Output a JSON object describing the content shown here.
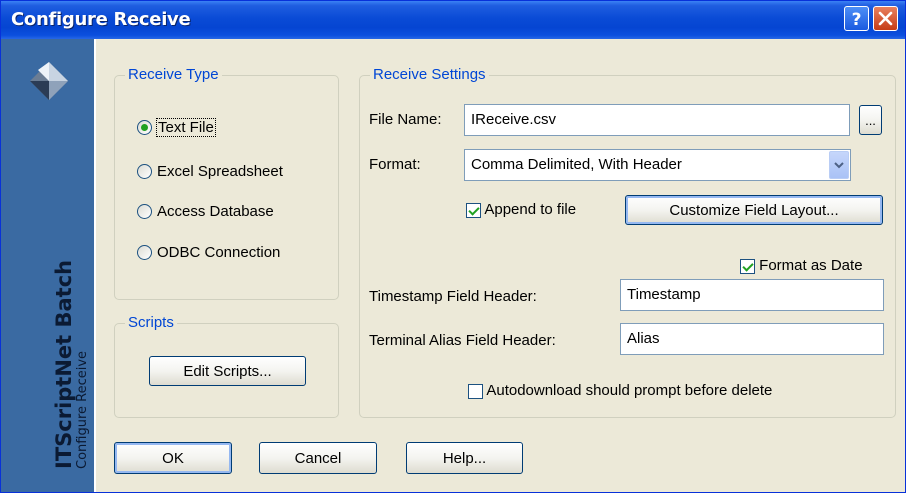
{
  "window": {
    "title": "Configure Receive",
    "help_icon": "question-mark-icon",
    "close_icon": "close-icon"
  },
  "sidebar": {
    "product": "ITScriptNet Batch",
    "subtitle": "Configure Receive",
    "logo_icon": "diamond-logo-icon"
  },
  "receive_type": {
    "legend": "Receive Type",
    "options": [
      {
        "label": "Text File",
        "selected": true
      },
      {
        "label": "Excel Spreadsheet",
        "selected": false
      },
      {
        "label": "Access Database",
        "selected": false
      },
      {
        "label": "ODBC Connection",
        "selected": false
      }
    ]
  },
  "scripts": {
    "legend": "Scripts",
    "edit_label": "Edit Scripts..."
  },
  "settings": {
    "legend": "Receive Settings",
    "file_name_label": "File Name:",
    "file_name_value": "IReceive.csv",
    "browse_label": "...",
    "format_label": "Format:",
    "format_value": "Comma Delimited, With Header",
    "append_label": "Append to file",
    "append_checked": true,
    "customize_label": "Customize Field Layout...",
    "format_date_label": "Format as Date",
    "format_date_checked": true,
    "timestamp_label": "Timestamp Field Header:",
    "timestamp_value": "Timestamp",
    "alias_label": "Terminal Alias Field Header:",
    "alias_value": "Alias",
    "autodownload_label": "Autodownload should prompt before delete",
    "autodownload_checked": false
  },
  "buttons": {
    "ok": "OK",
    "cancel": "Cancel",
    "help": "Help..."
  },
  "colors": {
    "titlebar": "#0a4bd6",
    "sidebar": "#3a6aa2",
    "dialog_bg": "#ece9d8",
    "legend": "#0046d5",
    "check_green": "#21a121"
  }
}
